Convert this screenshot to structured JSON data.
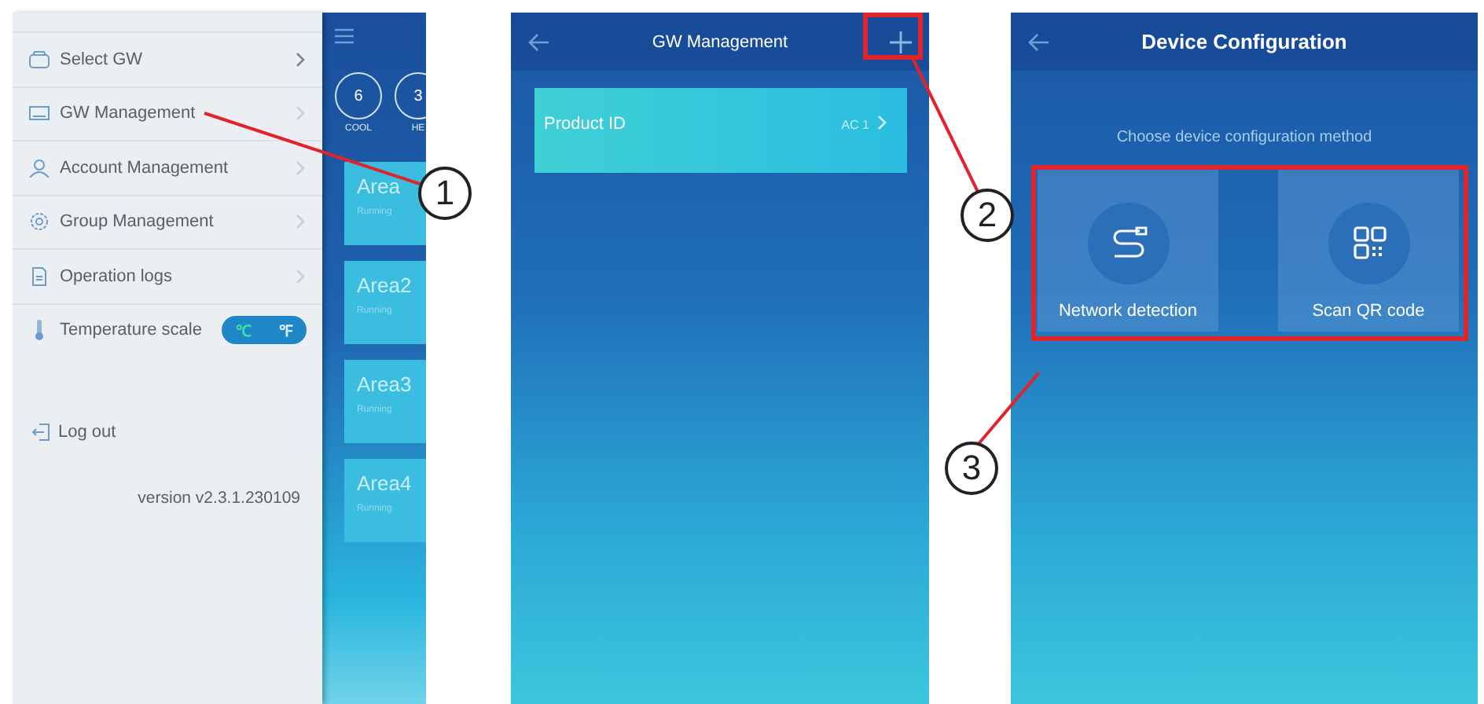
{
  "drawer": {
    "items": [
      {
        "kind": "link",
        "label": "Select GW"
      },
      {
        "kind": "link",
        "label": "GW Management"
      },
      {
        "kind": "link",
        "label": "Account Management"
      },
      {
        "kind": "link",
        "label": "Group Management"
      },
      {
        "kind": "link",
        "label": "Operation logs"
      },
      {
        "kind": "toggle",
        "label": "Temperature scale",
        "options": [
          {
            "label": "℃",
            "selected": true
          },
          {
            "label": "℉",
            "selected": false
          }
        ]
      }
    ],
    "logout": "Log out",
    "version": "version v2.3.1.230109"
  },
  "home_peek": {
    "modes": [
      {
        "count": "6",
        "label": "COOL"
      },
      {
        "count": "3",
        "label": "HE"
      }
    ],
    "areas": [
      {
        "name": "Area",
        "status": "Running"
      },
      {
        "name": "Area2",
        "status": "Running"
      },
      {
        "name": "Area3",
        "status": "Running"
      },
      {
        "name": "Area4",
        "status": "Running"
      }
    ]
  },
  "gw_management": {
    "title": "GW Management",
    "rows": [
      {
        "label": "Product ID",
        "value": "AC 1"
      }
    ]
  },
  "device_configuration": {
    "title": "Device Configuration",
    "prompt": "Choose device configuration method",
    "methods": [
      {
        "kind": "network",
        "label": "Network detection"
      },
      {
        "kind": "qr",
        "label": "Scan QR code"
      }
    ]
  },
  "callouts": [
    {
      "number": "1"
    },
    {
      "number": "2"
    },
    {
      "number": "3"
    }
  ]
}
